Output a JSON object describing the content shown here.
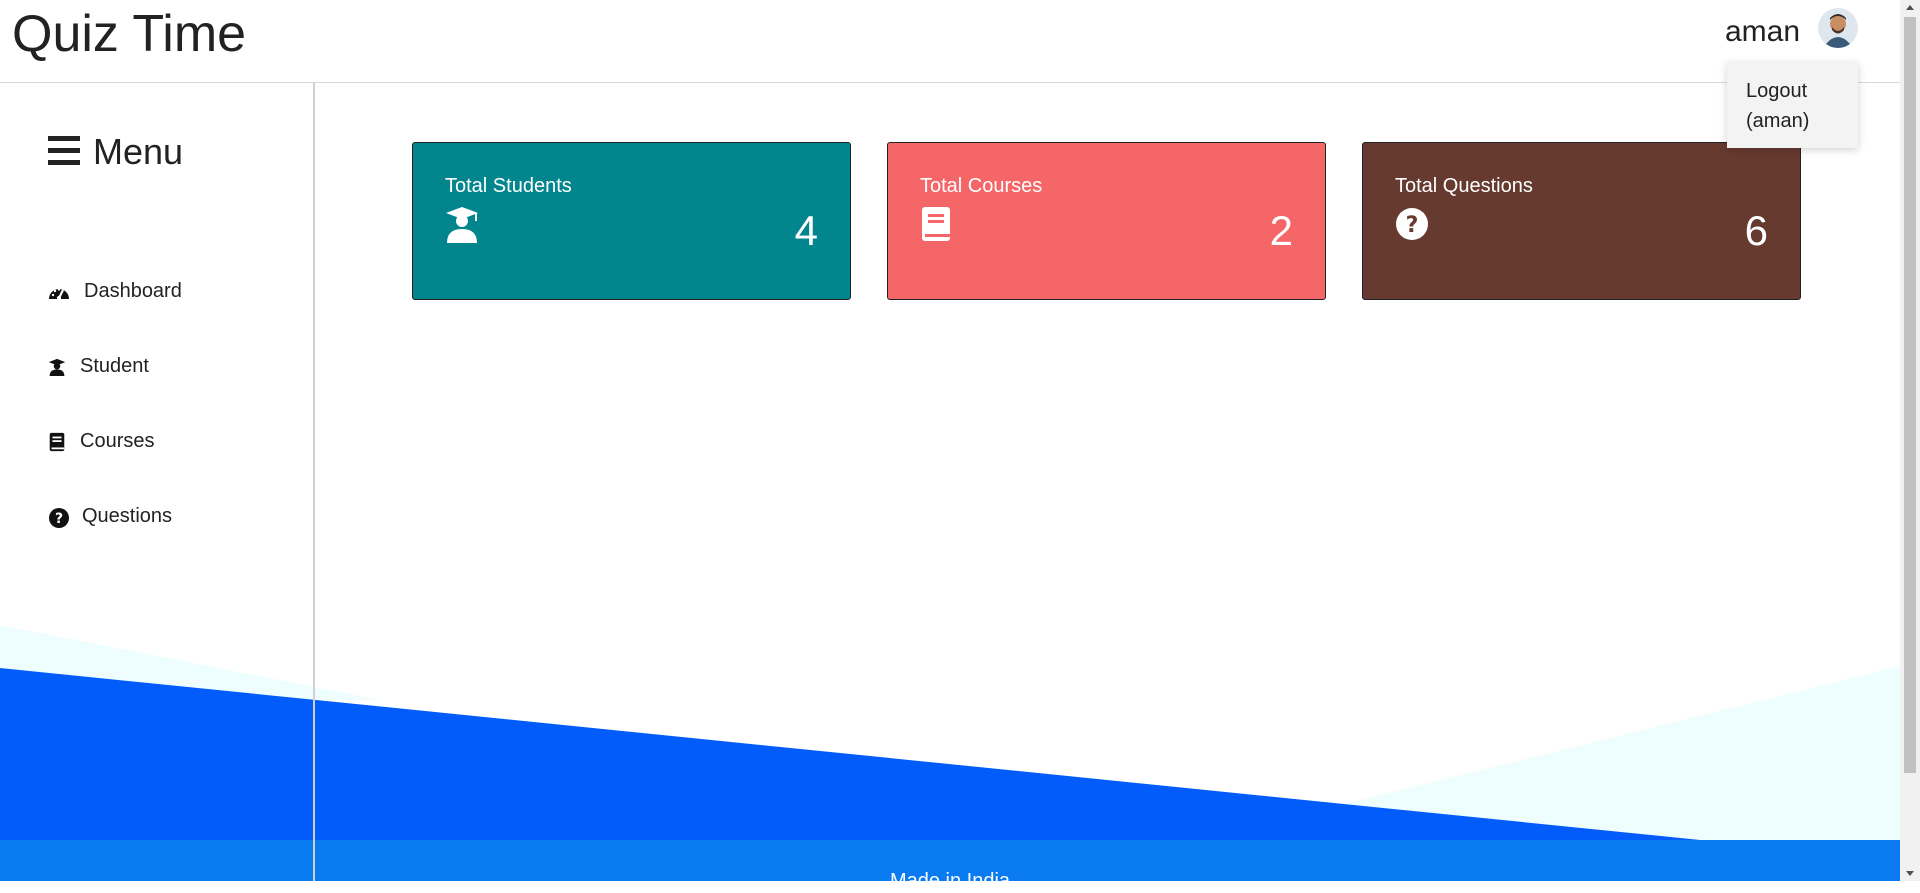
{
  "header": {
    "title": "Quiz Time",
    "user_name": "aman",
    "dropdown": {
      "logout_label": "Logout (aman)"
    }
  },
  "sidebar": {
    "menu_label": "Menu",
    "items": [
      {
        "label": "Dashboard",
        "icon": "tachometer-icon"
      },
      {
        "label": "Student",
        "icon": "user-graduate-icon"
      },
      {
        "label": "Courses",
        "icon": "book-icon"
      },
      {
        "label": "Questions",
        "icon": "question-circle-icon"
      }
    ]
  },
  "cards": [
    {
      "title": "Total Students",
      "value": "4",
      "icon": "user-graduate-icon",
      "color": "#03858d"
    },
    {
      "title": "Total Courses",
      "value": "2",
      "icon": "book-icon",
      "color": "#f46667"
    },
    {
      "title": "Total Questions",
      "value": "6",
      "icon": "question-circle-icon",
      "color": "#673a30"
    }
  ],
  "footer": {
    "text": "Made in India"
  },
  "colors": {
    "wave_dark": "#015cfb",
    "wave_light": "#eefeff",
    "footer": "#0a7af0",
    "user_underline": "#2222cc"
  }
}
